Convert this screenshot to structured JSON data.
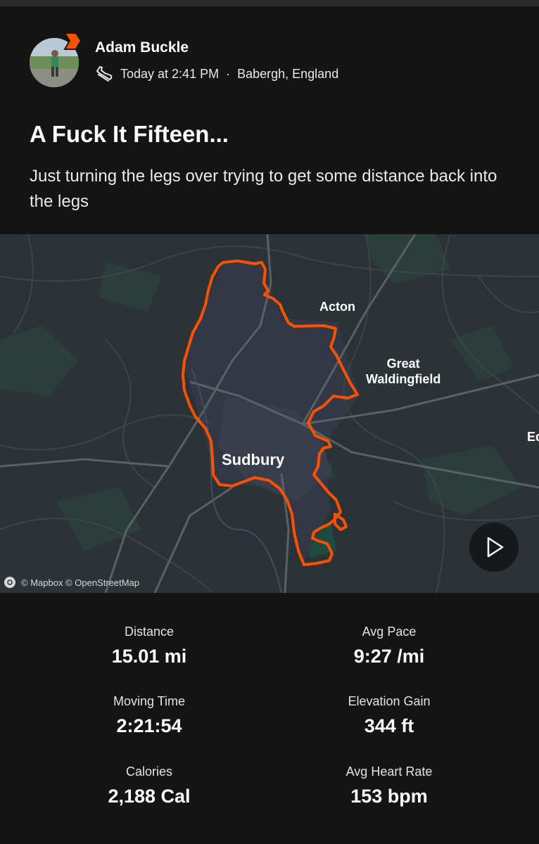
{
  "athlete": {
    "name": "Adam Buckle",
    "timestamp": "Today at 2:41 PM",
    "separator": "·",
    "location": "Babergh, England",
    "activity_icon": "running-shoe-icon",
    "badge_icon": "subscriber-chevron-icon"
  },
  "activity": {
    "title": "A Fuck It Fifteen...",
    "description": "Just turning the legs over trying to get some distance back into the legs"
  },
  "map": {
    "labels": {
      "acton": "Acton",
      "great_waldingfield_line1": "Great",
      "great_waldingfield_line2": "Waldingfield",
      "sudbury": "Sudbury",
      "edge": "Ed"
    },
    "attribution": "© Mapbox © OpenStreetMap",
    "route_color": "#fc5200"
  },
  "stats": [
    {
      "label": "Distance",
      "value": "15.01 mi"
    },
    {
      "label": "Avg Pace",
      "value": "9:27 /mi"
    },
    {
      "label": "Moving Time",
      "value": "2:21:54"
    },
    {
      "label": "Elevation Gain",
      "value": "344 ft"
    },
    {
      "label": "Calories",
      "value": "2,188 Cal"
    },
    {
      "label": "Avg Heart Rate",
      "value": "153 bpm"
    }
  ]
}
